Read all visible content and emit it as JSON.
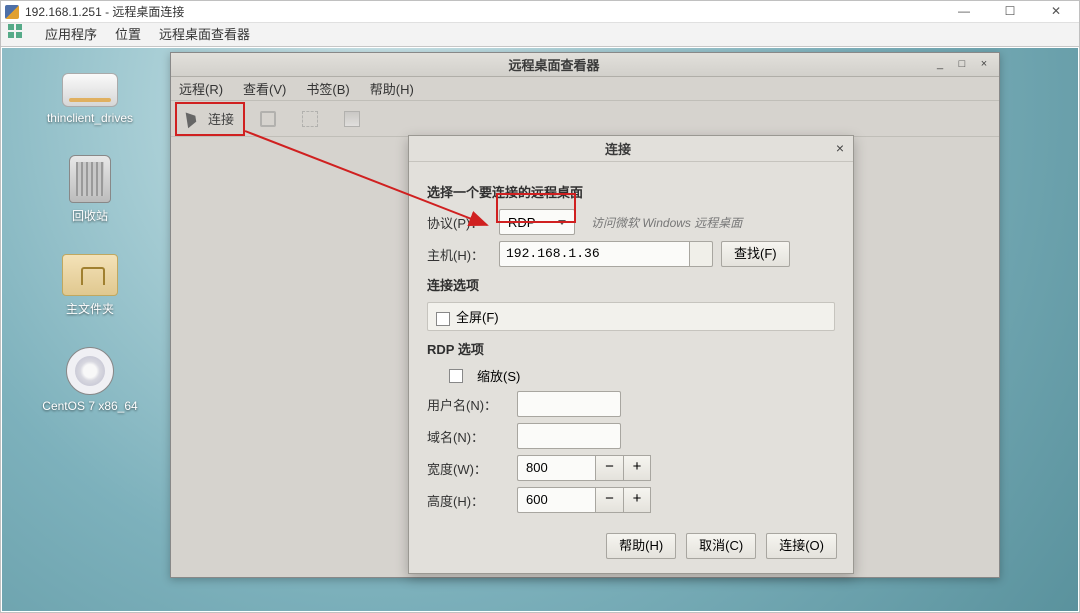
{
  "outer": {
    "title": "192.168.1.251 - 远程桌面连接",
    "min": "—",
    "max": "☐",
    "close": "✕"
  },
  "host_menu": {
    "apps": "应用程序",
    "location": "位置",
    "viewer": "远程桌面查看器"
  },
  "desktop": {
    "drive": "thinclient_drives",
    "trash": "回收站",
    "home": "主文件夹",
    "disc": "CentOS 7 x86_64"
  },
  "remmina": {
    "title": "远程桌面查看器",
    "title_min": "_",
    "title_max": "□",
    "title_close": "×",
    "menu": {
      "remote": "远程(R)",
      "view": "查看(V)",
      "bookmark": "书签(B)",
      "help": "帮助(H)"
    },
    "toolbar": {
      "connect": "连接"
    }
  },
  "dialog": {
    "title": "连接",
    "close": "×",
    "section_choose": "选择一个要连接的远程桌面",
    "proto_label": "协议(P)：",
    "proto_value": "RDP",
    "proto_hint": "访问微软 Windows 远程桌面",
    "host_label": "主机(H)：",
    "host_value": "192.168.1.36",
    "find_btn": "查找(F)",
    "section_conn": "连接选项",
    "fullscreen": "全屏(F)",
    "section_rdp": "RDP 选项",
    "scale": "缩放(S)",
    "user_label": "用户名(N)：",
    "user_value": "",
    "domain_label": "域名(N)：",
    "domain_value": "",
    "width_label": "宽度(W)：",
    "width_value": "800",
    "height_label": "高度(H)：",
    "height_value": "600",
    "minus": "−",
    "plus": "+",
    "btn_help": "帮助(H)",
    "btn_cancel": "取消(C)",
    "btn_connect": "连接(O)"
  }
}
